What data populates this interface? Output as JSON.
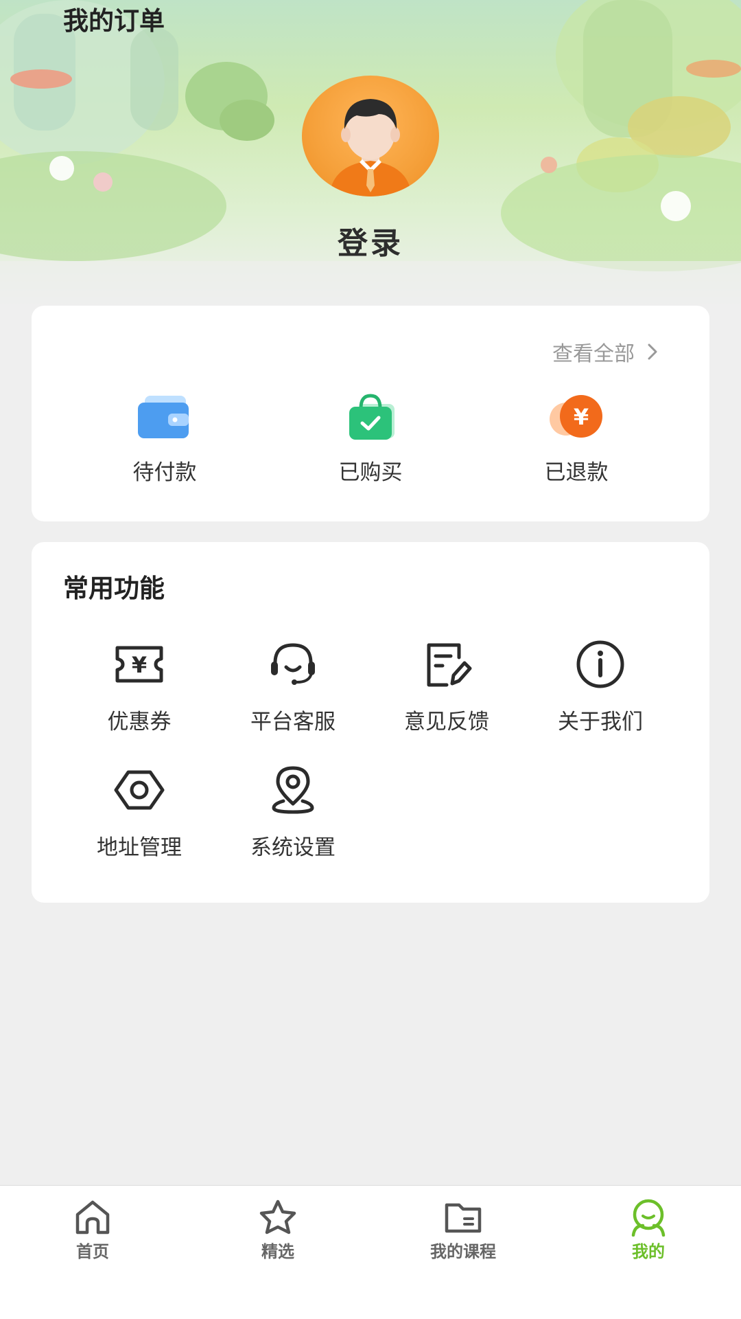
{
  "profile": {
    "login_label": "登录"
  },
  "orders": {
    "title": "我的订单",
    "view_all": "查看全部",
    "items": [
      {
        "label": "待付款",
        "icon": "wallet-icon"
      },
      {
        "label": "已购买",
        "icon": "shopping-bag-check-icon"
      },
      {
        "label": "已退款",
        "icon": "refund-yuan-icon"
      }
    ]
  },
  "functions": {
    "title": "常用功能",
    "items": [
      {
        "label": "优惠券",
        "icon": "coupon-yuan-icon"
      },
      {
        "label": "平台客服",
        "icon": "headset-icon"
      },
      {
        "label": "意见反馈",
        "icon": "feedback-edit-icon"
      },
      {
        "label": "关于我们",
        "icon": "info-icon"
      },
      {
        "label": "地址管理",
        "icon": "hexagon-address-icon"
      },
      {
        "label": "系统设置",
        "icon": "location-pin-icon"
      }
    ]
  },
  "tabbar": {
    "items": [
      {
        "label": "首页",
        "icon": "home-icon"
      },
      {
        "label": "精选",
        "icon": "star-icon"
      },
      {
        "label": "我的课程",
        "icon": "folder-icon"
      },
      {
        "label": "我的",
        "icon": "user-icon",
        "active": true
      }
    ],
    "active_color": "#6cbf2a",
    "inactive_color": "#666666"
  },
  "colors": {
    "page_background": "#efefef",
    "card_background": "#ffffff",
    "accent_green": "#6cbf2a",
    "avatar_orange": "#f5a03a"
  }
}
